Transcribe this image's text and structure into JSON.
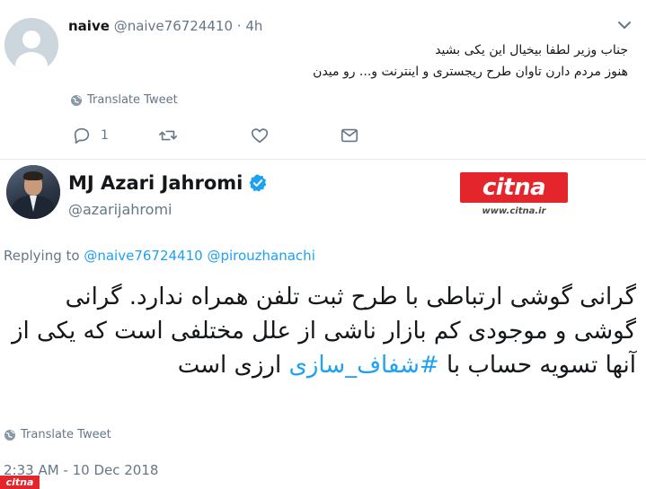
{
  "reply_tweet": {
    "name": "naive",
    "handle": "@naive76724410",
    "time": " · 4h",
    "text_line1": "جناب وزیر لطفا بیخیال این یکی بشید",
    "text_line2": "هنوز مردم دارن تاوان طرح ریجستری و اینترنت و... رو میدن",
    "translate_label": "Translate Tweet",
    "reply_count": "1"
  },
  "main_tweet": {
    "name": "MJ Azari Jahromi",
    "handle": "@azarijahromi",
    "replying_prefix": "Replying to ",
    "replying_user1": "@naive76724410",
    "replying_user2": "@pirouzhanachi",
    "text": "گرانی گوشی ارتباطی با طرح ثبت تلفن همراه ندارد. گرانی گوشی و موجودی کم بازار ناشی از علل مختلفی است که یکی از آنها تسویه حساب با ",
    "hashtag": "#شفاف_سازی",
    "text_end": " ارزی است",
    "translate_label": "Translate Tweet",
    "timestamp": "2:33 AM - 10 Dec 2018"
  },
  "watermark": {
    "logo_text": "citna",
    "url": "www.citna.ir",
    "badge_text": "citna"
  },
  "colors": {
    "accent": "#1da1f2",
    "muted": "#657786",
    "brand_red": "#e4252b"
  },
  "icons": [
    "chevron-down-icon",
    "globe-icon",
    "reply-icon",
    "retweet-icon",
    "like-icon",
    "dm-icon",
    "verified-icon"
  ]
}
